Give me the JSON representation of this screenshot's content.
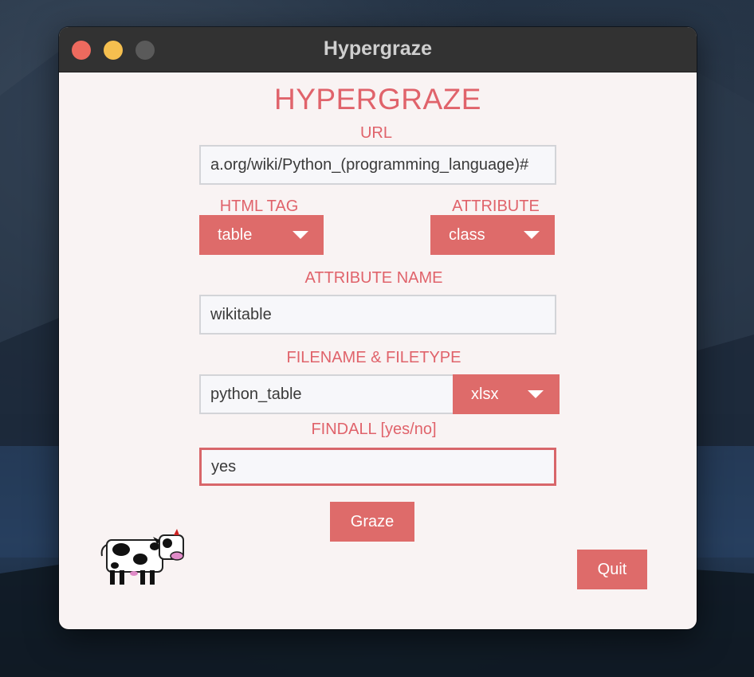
{
  "window": {
    "title": "Hypergraze"
  },
  "app": {
    "heading": "HYPERGRAZE"
  },
  "form": {
    "url_label": "URL",
    "url_value": "a.org/wiki/Python_(programming_language)#",
    "html_tag_label": "HTML TAG",
    "html_tag_value": "table",
    "attribute_label": "ATTRIBUTE",
    "attribute_value": "class",
    "attribute_name_label": "ATTRIBUTE NAME",
    "attribute_name_value": "wikitable",
    "filename_label": "FILENAME & FILETYPE",
    "filename_value": "python_table",
    "filetype_value": "xlsx",
    "findall_label": "FINDALL [yes/no]",
    "findall_value": "yes"
  },
  "buttons": {
    "graze": "Graze",
    "quit": "Quit"
  },
  "icons": {
    "mascot": "cow-icon",
    "dropdown": "caret-down-icon"
  },
  "colors": {
    "accent": "#de6b6a",
    "label_text": "#e0636b",
    "window_bg": "#f9f3f3",
    "titlebar": "#323232",
    "close": "#ed6a5e",
    "minimize": "#f5bf4f",
    "maximize": "#5a5a5a"
  }
}
